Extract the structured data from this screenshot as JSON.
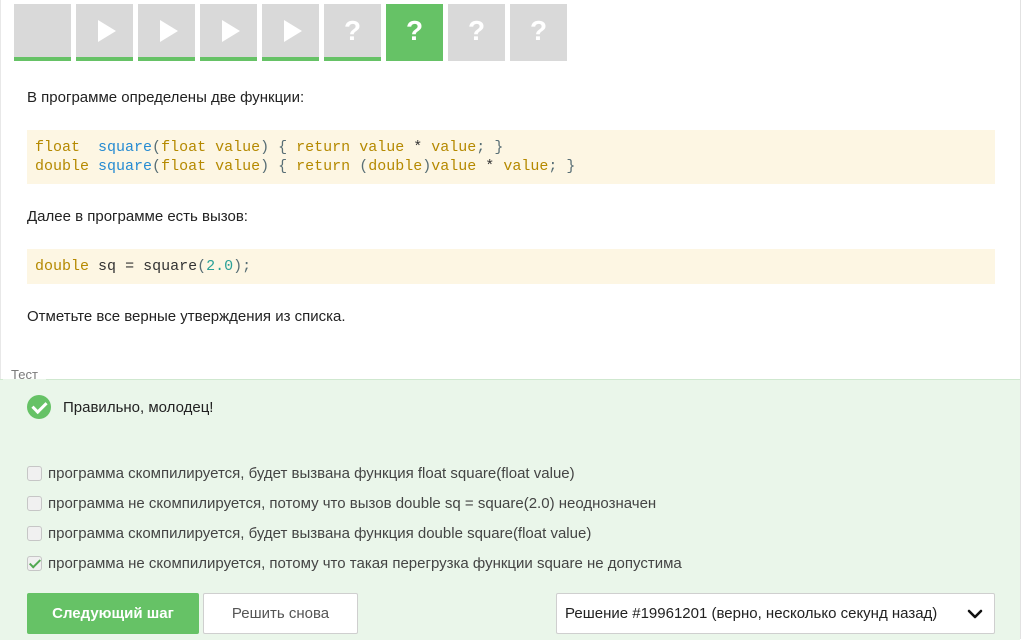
{
  "steps": [
    {
      "type": "blank",
      "state": "done"
    },
    {
      "type": "video",
      "icon": "play-icon",
      "state": "done"
    },
    {
      "type": "video",
      "icon": "play-icon",
      "state": "done"
    },
    {
      "type": "video",
      "icon": "play-icon",
      "state": "done"
    },
    {
      "type": "video",
      "icon": "play-icon",
      "state": "done"
    },
    {
      "type": "quiz",
      "label": "?",
      "state": "done"
    },
    {
      "type": "quiz",
      "label": "?",
      "state": "current"
    },
    {
      "type": "quiz",
      "label": "?",
      "state": "pending"
    },
    {
      "type": "quiz",
      "label": "?",
      "state": "pending"
    }
  ],
  "content": {
    "intro": "В программе определены две функции:",
    "code1": {
      "line1": {
        "t1": "float",
        "t2": "square",
        "t3": "(",
        "t4": "float",
        "t5": "value",
        "t6": ")",
        "t7": "{",
        "t8": "return",
        "t9": "value",
        "t10": "*",
        "t11": "value",
        "t12": ";",
        "t13": "}"
      },
      "line2": {
        "t1": "double",
        "t2": "square",
        "t3": "(",
        "t4": "float",
        "t5": "value",
        "t6": ")",
        "t7": "{",
        "t8": "return",
        "t9": "(",
        "t10": "double",
        "t11": ")",
        "t12": "value",
        "t13": "*",
        "t14": "value",
        "t15": ";",
        "t16": "}"
      }
    },
    "middle": "Далее в программе есть вызов:",
    "code2": {
      "t1": "double",
      "t2": "sq",
      "t3": "=",
      "t4": "square",
      "t5": "(",
      "t6": "2.0",
      "t7": ");"
    },
    "prompt": "Отметьте все верные утверждения из списка."
  },
  "quiz": {
    "label": "Тест",
    "status": "Правильно, молодец!",
    "options": [
      {
        "text": "программа скомпилируется, будет вызвана функция float square(float value)",
        "checked": false
      },
      {
        "text": "программа не скомпилируется, потому что вызов double sq = square(2.0) неоднозначен",
        "checked": false
      },
      {
        "text": "программа скомпилируется, будет вызвана функция double square(float value)",
        "checked": false
      },
      {
        "text": "программа не скомпилируется, потому что такая перегрузка функции square не допустима",
        "checked": true
      }
    ],
    "next_label": "Следующий шаг",
    "retry_label": "Решить снова",
    "solution_select": "Решение #19961201 (верно, несколько секунд назад)"
  },
  "colors": {
    "accent": "#66c266",
    "tab_inactive": "#d9d9d9",
    "quiz_bg": "#eaf6ea",
    "code_bg": "#fdf6e3"
  }
}
